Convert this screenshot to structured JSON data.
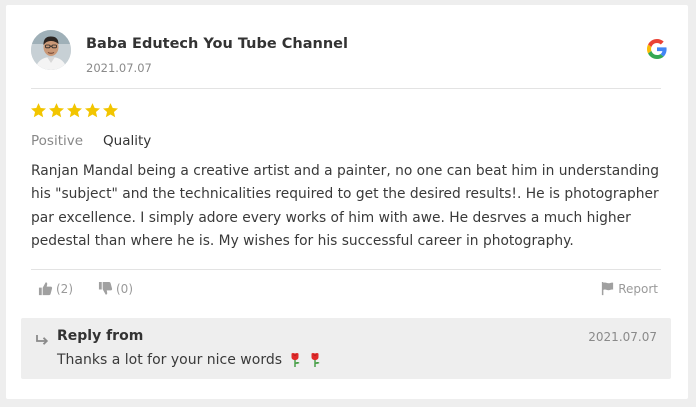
{
  "review": {
    "reviewer_name": "Baba Edutech You Tube Channel",
    "date": "2021.07.07",
    "source_icon": "google-g-icon",
    "rating": 5,
    "rating_max": 5,
    "star_color": "#f2c500",
    "sentiment": "Positive",
    "category": "Quality",
    "text": "Ranjan Mandal being a creative artist and a painter, no one can beat him in understanding his \"subject\" and the technicalities required to get the desired results!. He is photographer par excellence. I simply adore every works of him with awe. He desrves a much higher pedestal than where he is. My wishes for his successful career in photography."
  },
  "actions": {
    "helpful_count": "(2)",
    "unhelpful_count": "(0)",
    "report_label": "Report"
  },
  "reply": {
    "title": "Reply from",
    "date": "2021.07.07",
    "text": "Thanks a lot for your nice words",
    "emoji": [
      "rose-icon",
      "rose-icon"
    ]
  },
  "colors": {
    "page_background": "#eeeeee",
    "card_background": "#ffffff",
    "reply_background": "#eeeeee",
    "muted_text": "#8a8a8a"
  }
}
